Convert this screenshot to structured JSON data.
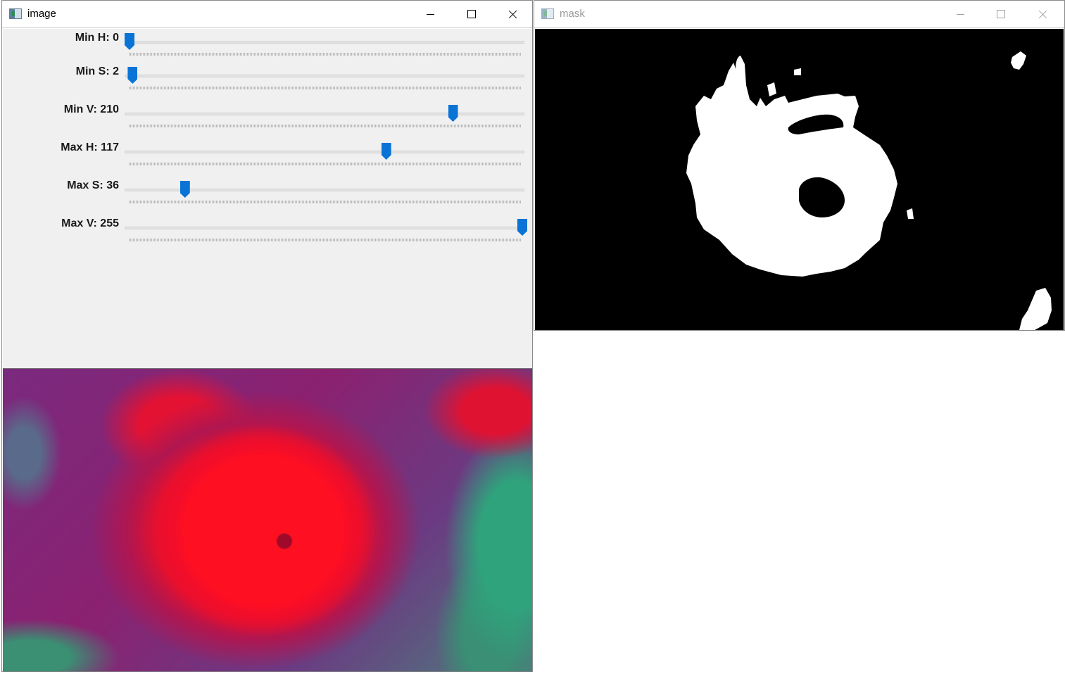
{
  "windows": {
    "image": {
      "title": "image",
      "trackbars": [
        {
          "label": "Min H: 0",
          "value": 0,
          "max": 179
        },
        {
          "label": "Min S: 2",
          "value": 2,
          "max": 255
        },
        {
          "label": "Min V: 210",
          "value": 210,
          "max": 255
        },
        {
          "label": "Max H: 117",
          "value": 117,
          "max": 179
        },
        {
          "label": "Max S: 36",
          "value": 36,
          "max": 255
        },
        {
          "label": "Max V: 255",
          "value": 255,
          "max": 255
        }
      ]
    },
    "mask": {
      "title": "mask"
    }
  },
  "colors": {
    "thumb": "#0a74d6",
    "controls_bg": "#f0f0f0",
    "mask_bg": "#000000",
    "mask_fg": "#ffffff"
  }
}
